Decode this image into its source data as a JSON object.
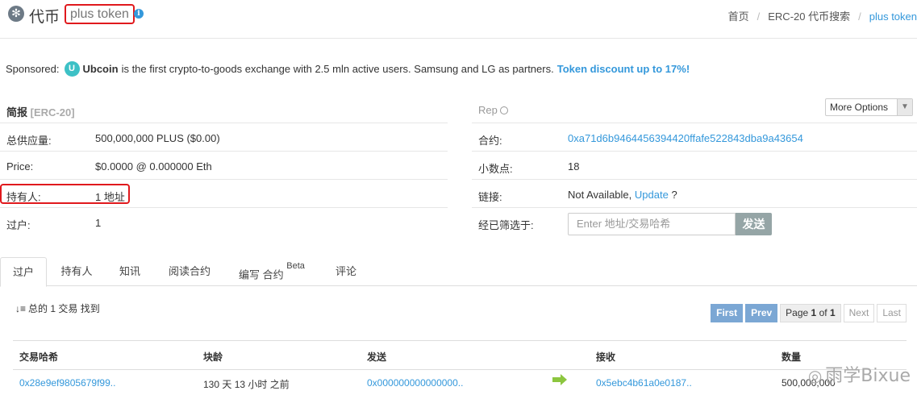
{
  "header": {
    "title": "代币",
    "token_name": "plus token",
    "breadcrumb": [
      "首页",
      "ERC-20 代币搜索",
      "plus token"
    ]
  },
  "sponsored": {
    "label": "Sponsored:",
    "brand": "Ubcoin",
    "text": "is the first crypto-to-goods exchange with 2.5 mln active users. Samsung and LG as partners.",
    "cta": "Token discount up to 17%!"
  },
  "overview": {
    "title": "简报",
    "subtitle": "[ERC-20]",
    "rows": [
      {
        "key": "总供应量:",
        "value": "500,000,000 PLUS ($0.00)"
      },
      {
        "key": "Price:",
        "value": "$0.0000 @ 0.000000 Eth"
      },
      {
        "key": "持有人:",
        "value": "1 地址"
      },
      {
        "key": "过户:",
        "value": "1"
      }
    ]
  },
  "reputation": {
    "label": "Rep",
    "more_options": "More Options",
    "contract_label": "合约:",
    "contract_value": "0xa71d6b9464456394420ffafe522843dba9a43654",
    "decimals_label": "小数点:",
    "decimals_value": "18",
    "links_label": "链接:",
    "links_value": "Not Available,",
    "links_update": "Update",
    "links_suffix": "?",
    "filter_label": "经已筛选于:",
    "filter_placeholder": "Enter 地址/交易哈希",
    "filter_button": "发送"
  },
  "tabs": [
    {
      "label": "过户",
      "active": true
    },
    {
      "label": "持有人"
    },
    {
      "label": "知讯"
    },
    {
      "label": "阅读合约"
    },
    {
      "label": "编写 合约",
      "sup": "Beta"
    },
    {
      "label": "评论"
    }
  ],
  "transfers": {
    "summary": "总的 1 交易 找到",
    "pager": {
      "first": "First",
      "prev": "Prev",
      "page_label": "Page",
      "page": "1",
      "of": "of",
      "total": "1",
      "next": "Next",
      "last": "Last"
    },
    "columns": [
      "交易哈希",
      "块龄",
      "发送",
      "接收",
      "数量"
    ],
    "rows": [
      {
        "hash": "0x28e9ef9805679f99..",
        "age": "130 天 13 小时 之前",
        "from": "0x000000000000000..",
        "to": "0x5ebc4b61a0e0187..",
        "quantity": "500,000,000"
      }
    ]
  },
  "watermark": "雨学Bixue",
  "colors": {
    "link": "#3498db",
    "highlight": "#e0191d",
    "pager_blue": "#7ba7d4",
    "arrow_green": "#8cc63f"
  }
}
